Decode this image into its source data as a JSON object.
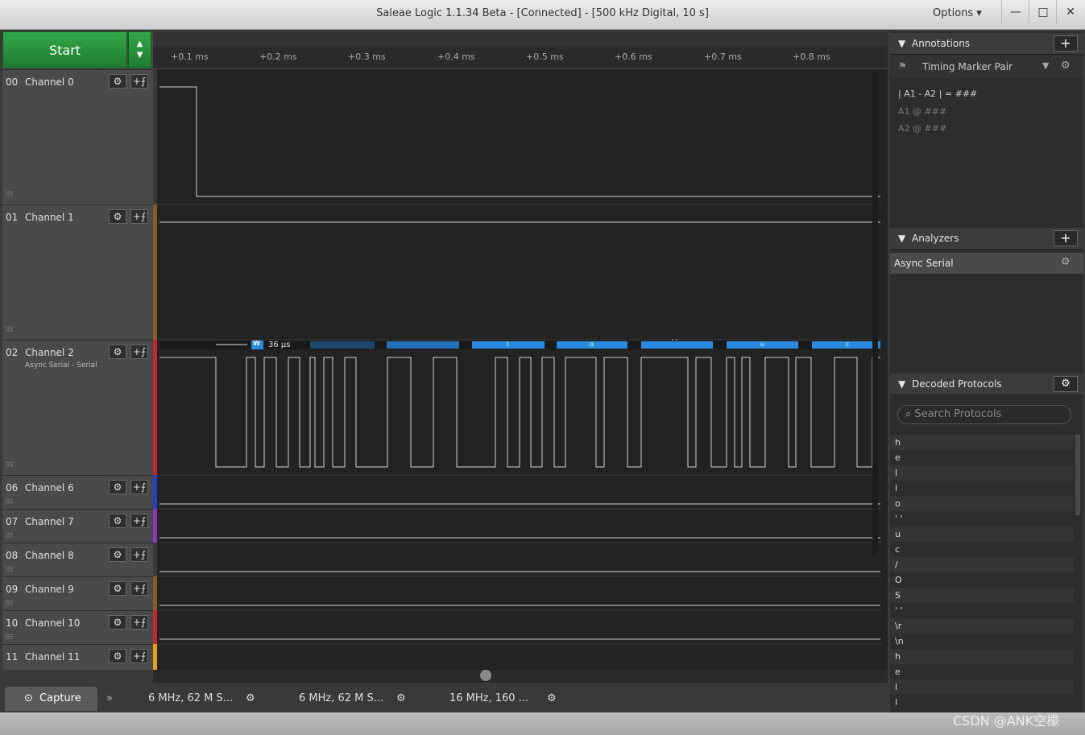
{
  "window": {
    "title": "Saleae Logic 1.1.34 Beta - [Connected] - [500 kHz Digital, 10 s]",
    "options_label": "Options ▾",
    "min_icon": "—",
    "max_icon": "□",
    "close_icon": "✕"
  },
  "controls": {
    "start_label": "Start"
  },
  "ruler": {
    "ticks": [
      "+0.1 ms",
      "+0.2 ms",
      "+0.3 ms",
      "+0.4 ms",
      "+0.5 ms",
      "+0.6 ms",
      "+0.7 ms",
      "+0.8 ms"
    ]
  },
  "channels": [
    {
      "num": "00",
      "name": "Channel 0",
      "sub": "",
      "color": "#3a3a3a"
    },
    {
      "num": "01",
      "name": "Channel 1",
      "sub": "",
      "color": "#8a5a2a"
    },
    {
      "num": "02",
      "name": "Channel 2",
      "sub": "Async Serial - Serial",
      "color": "#c0282a"
    },
    {
      "num": "06",
      "name": "Channel 6",
      "sub": "",
      "color": "#2a3fbf"
    },
    {
      "num": "07",
      "name": "Channel 7",
      "sub": "",
      "color": "#8a3ab9"
    },
    {
      "num": "08",
      "name": "Channel 8",
      "sub": "",
      "color": "#3a3a3a"
    },
    {
      "num": "09",
      "name": "Channel 9",
      "sub": "",
      "color": "#8a5a2a"
    },
    {
      "num": "10",
      "name": "Channel 10",
      "sub": "",
      "color": "#c0282a"
    },
    {
      "num": "11",
      "name": "Channel 11",
      "sub": "",
      "color": "#e0a020"
    }
  ],
  "measurement": {
    "badge": "W",
    "width": "36 µs"
  },
  "decoded_bubbles": [
    "l",
    "o",
    "' '",
    "u",
    "c"
  ],
  "bottom_tabs": {
    "capture": "Capture",
    "tab1": "6 MHz, 62 M S...",
    "tab2": "6 MHz, 62 M S...",
    "tab3": "16 MHz, 160 ..."
  },
  "annotations": {
    "header": "Annotations",
    "marker": "Timing Marker Pair",
    "line1": "| A1 - A2 | = ###",
    "line2": "A1  @  ###",
    "line3": "A2  @  ###"
  },
  "analyzers": {
    "header": "Analyzers",
    "item": "Async Serial"
  },
  "decoded": {
    "header": "Decoded Protocols",
    "search_placeholder": "Search Protocols",
    "rows": [
      "h",
      "e",
      "l",
      "l",
      "o",
      "' '",
      "u",
      "c",
      "/",
      "O",
      "S",
      "' '",
      "\\r",
      "\\n",
      "h",
      "e",
      "l",
      "l"
    ]
  },
  "watermark": "CSDN @ANK空檬"
}
